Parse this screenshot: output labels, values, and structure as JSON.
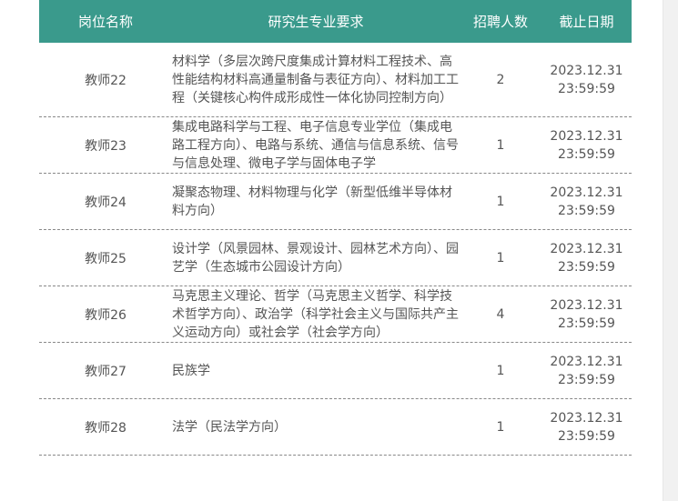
{
  "header": {
    "col1": "岗位名称",
    "col2": "研究生专业要求",
    "col3": "招聘人数",
    "col4": "截止日期"
  },
  "rows": [
    {
      "name": "教师22",
      "major": "材料学（多层次跨尺度集成计算材料工程技术、高性能结构材料高通量制备与表征方向）、材料加工工程（关键核心构件成形成性一体化协同控制方向）",
      "count": "2",
      "date": "2023.12.31",
      "time": "23:59:59"
    },
    {
      "name": "教师23",
      "major": "集成电路科学与工程、电子信息专业学位（集成电路工程方向）、电路与系统、通信与信息系统、信号与信息处理、微电子学与固体电子学",
      "count": "1",
      "date": "2023.12.31",
      "time": "23:59:59"
    },
    {
      "name": "教师24",
      "major": "凝聚态物理、材料物理与化学（新型低维半导体材料方向）",
      "count": "1",
      "date": "2023.12.31",
      "time": "23:59:59"
    },
    {
      "name": "教师25",
      "major": "设计学（风景园林、景观设计、园林艺术方向）、园艺学（生态城市公园设计方向）",
      "count": "1",
      "date": "2023.12.31",
      "time": "23:59:59"
    },
    {
      "name": "教师26",
      "major": "马克思主义理论、哲学（马克思主义哲学、科学技术哲学方向）、政治学（科学社会主义与国际共产主义运动方向）或社会学（社会学方向）",
      "count": "4",
      "date": "2023.12.31",
      "time": "23:59:59"
    },
    {
      "name": "教师27",
      "major": "民族学",
      "count": "1",
      "date": "2023.12.31",
      "time": "23:59:59"
    },
    {
      "name": "教师28",
      "major": "法学（民法学方向）",
      "count": "1",
      "date": "2023.12.31",
      "time": "23:59:59"
    }
  ],
  "colors": {
    "header_bg": "#3a9a8c",
    "header_text": "#ffffff",
    "body_text": "#555555"
  }
}
